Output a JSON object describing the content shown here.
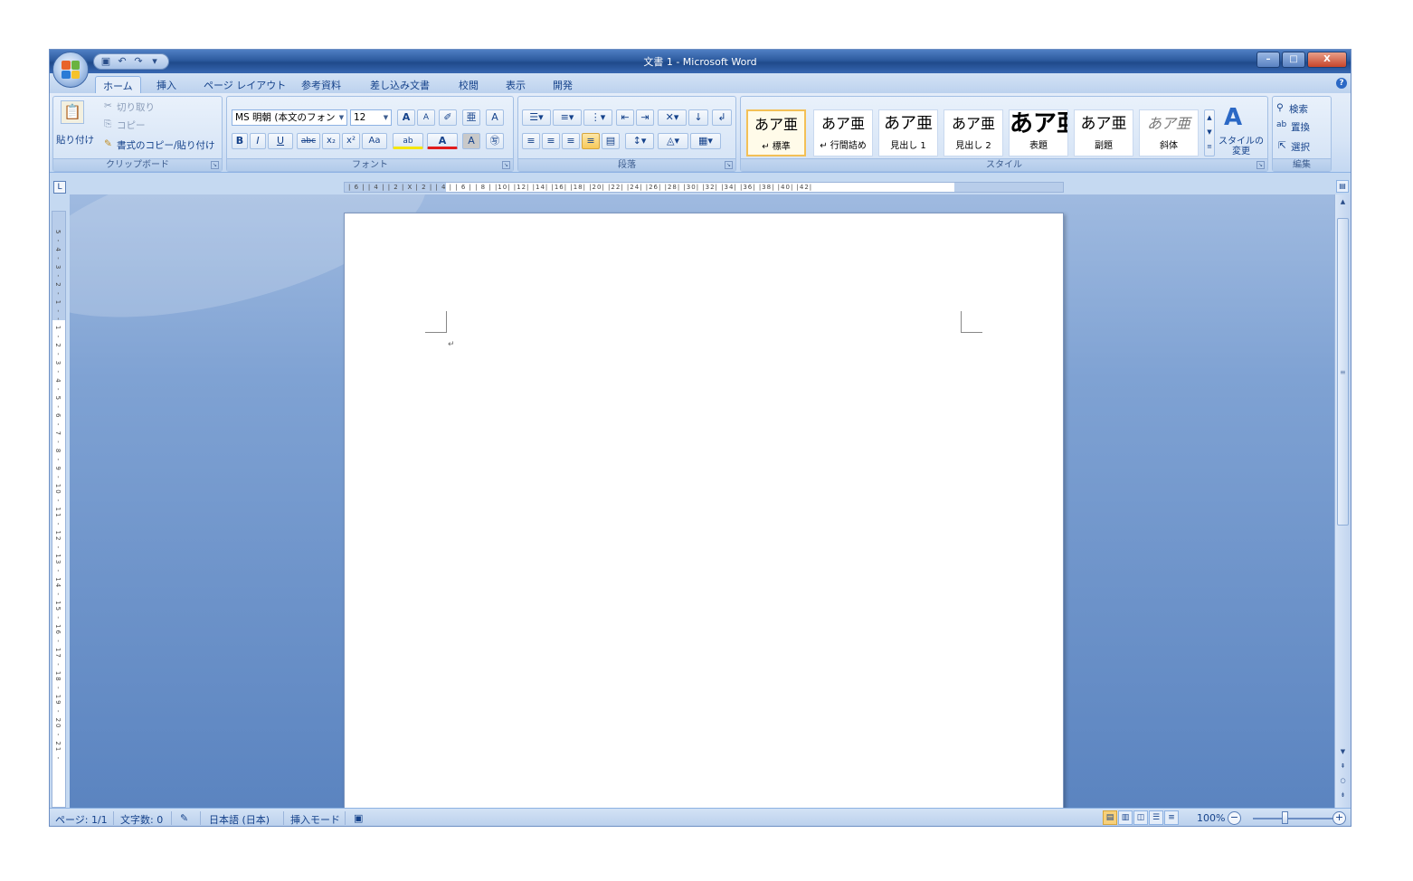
{
  "window": {
    "title": "文書 1 - Microsoft Word",
    "controls": {
      "minimize": "–",
      "maximize": "□",
      "close": "X"
    }
  },
  "quick_access": {
    "save_icon": "save-icon",
    "undo_icon": "undo-icon",
    "redo_icon": "redo-icon",
    "customize": "▾"
  },
  "tabs": [
    "ホーム",
    "挿入",
    "ページ レイアウト",
    "参考資料",
    "差し込み文書",
    "校閲",
    "表示",
    "開発"
  ],
  "help": "?",
  "clipboard": {
    "paste": "貼り付け",
    "cut": "切り取り",
    "copy": "コピー",
    "format_painter": "書式のコピー/貼り付け",
    "label": "クリップボード"
  },
  "font": {
    "name": "MS 明朝 (本文のフォン",
    "size": "12",
    "grow": "A",
    "shrink": "A",
    "bold": "B",
    "italic": "I",
    "underline": "U",
    "strike": "abc",
    "subscript": "x₂",
    "superscript": "x²",
    "change_case": "Aa",
    "highlight": "ab",
    "font_color": "A",
    "label": "フォント"
  },
  "paragraph": {
    "label": "段落",
    "show_marks": "↲"
  },
  "styles": {
    "label": "スタイル",
    "items": [
      {
        "sample": "あア亜",
        "name": "↵ 標準"
      },
      {
        "sample": "あア亜",
        "name": "↵ 行間詰め"
      },
      {
        "sample": "あア亜",
        "name": "見出し 1"
      },
      {
        "sample": "あア亜",
        "name": "見出し 2"
      },
      {
        "sample": "あア亜",
        "name": "表題"
      },
      {
        "sample": "あア亜",
        "name": "副題"
      },
      {
        "sample": "あア亜",
        "name": "斜体"
      }
    ],
    "change_styles": "スタイルの\n変更"
  },
  "editing": {
    "find": "検索",
    "replace": "置換",
    "select": "選択",
    "label": "編集"
  },
  "ruler": {
    "tab_selector": "L",
    "ticks": "| 6 |  | 4 |  | 2 |   X  | 2 |  | 4 |  | 6 |  | 8 |  |10|  |12|  |14|  |16|  |18|  |20|  |22|  |24|  |26|  |28|  |30|  |32|  |34|  |36|  |38|  |40|  |42|",
    "vticks": "5 - 4 - 3 - 2 - 1 - - 1 - 2 - 3 - 4 - 5 - 6 - 7 - 8 - 9 - 10 - 11 - 12 - 13 - 14 - 15 - 16 - 17 - 18 - 19 - 20 - 21 -"
  },
  "document": {
    "paragraph_mark": "↵"
  },
  "status": {
    "page": "ページ: 1/1",
    "words": "文字数: 0",
    "language": "日本語 (日本)",
    "mode": "挿入モード",
    "zoom": "100%"
  },
  "colors": {
    "accent": "#15428b",
    "ribbon": "#d6e4f6",
    "doc_bg": "#6b91c8"
  }
}
